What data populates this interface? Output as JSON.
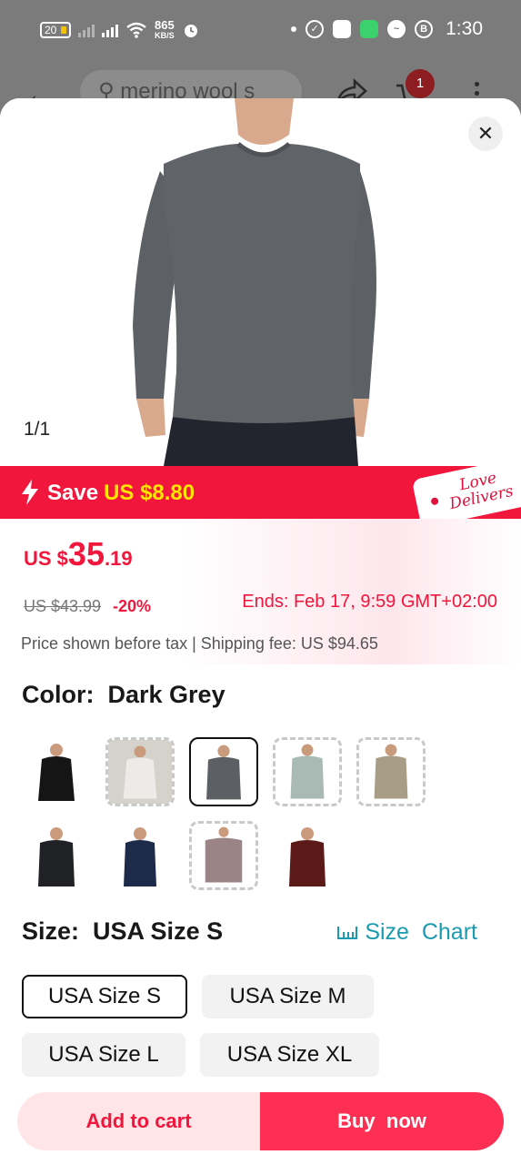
{
  "status_bar": {
    "battery": "20",
    "net_speed_value": "865",
    "net_speed_unit": "KB/S",
    "time": "1:30"
  },
  "nav": {
    "search_text": "merino wool s",
    "cart_count": "1"
  },
  "gallery": {
    "counter": "1/1"
  },
  "promo": {
    "save_label": "Save",
    "save_amount": "US $8.80",
    "badge_line1": "Love",
    "badge_line2": "Delivers"
  },
  "price": {
    "currency": "US $",
    "integer": "35",
    "decimal": ".19",
    "original": "US $43.99",
    "discount": "-20%",
    "ends": "Ends: Feb 17, 9:59 GMT+02:00",
    "tax_note": "Price shown before tax | Shipping fee: US $94.65"
  },
  "color": {
    "label": "Color:",
    "selected": "Dark Grey",
    "swatches": [
      {
        "name": "black",
        "hex": "#151515",
        "state": "normal"
      },
      {
        "name": "white",
        "hex": "#e8e6e2",
        "state": "dashed"
      },
      {
        "name": "dark-grey",
        "hex": "#5c5f63",
        "state": "selected"
      },
      {
        "name": "sage",
        "hex": "#a9bab4",
        "state": "dashed"
      },
      {
        "name": "khaki",
        "hex": "#a89d86",
        "state": "dashed"
      },
      {
        "name": "charcoal-black",
        "hex": "#1f2124",
        "state": "normal"
      },
      {
        "name": "navy",
        "hex": "#1d2a4a",
        "state": "normal"
      },
      {
        "name": "mauve",
        "hex": "#9a8486",
        "state": "dashed"
      },
      {
        "name": "burgundy",
        "hex": "#5b1a18",
        "state": "normal"
      }
    ]
  },
  "size": {
    "label": "Size:",
    "selected": "USA Size S",
    "chart_label": "Size  Chart",
    "options": [
      "USA Size S",
      "USA Size M",
      "USA Size L",
      "USA Size XL"
    ]
  },
  "actions": {
    "add_to_cart": "Add to cart",
    "buy_now": "Buy  now"
  },
  "colors": {
    "accent": "#f0163c",
    "buy_button": "#fd2f52",
    "add_button_bg": "#ffe5e8",
    "save_highlight": "#ffe500",
    "link": "#1a9bb0"
  }
}
